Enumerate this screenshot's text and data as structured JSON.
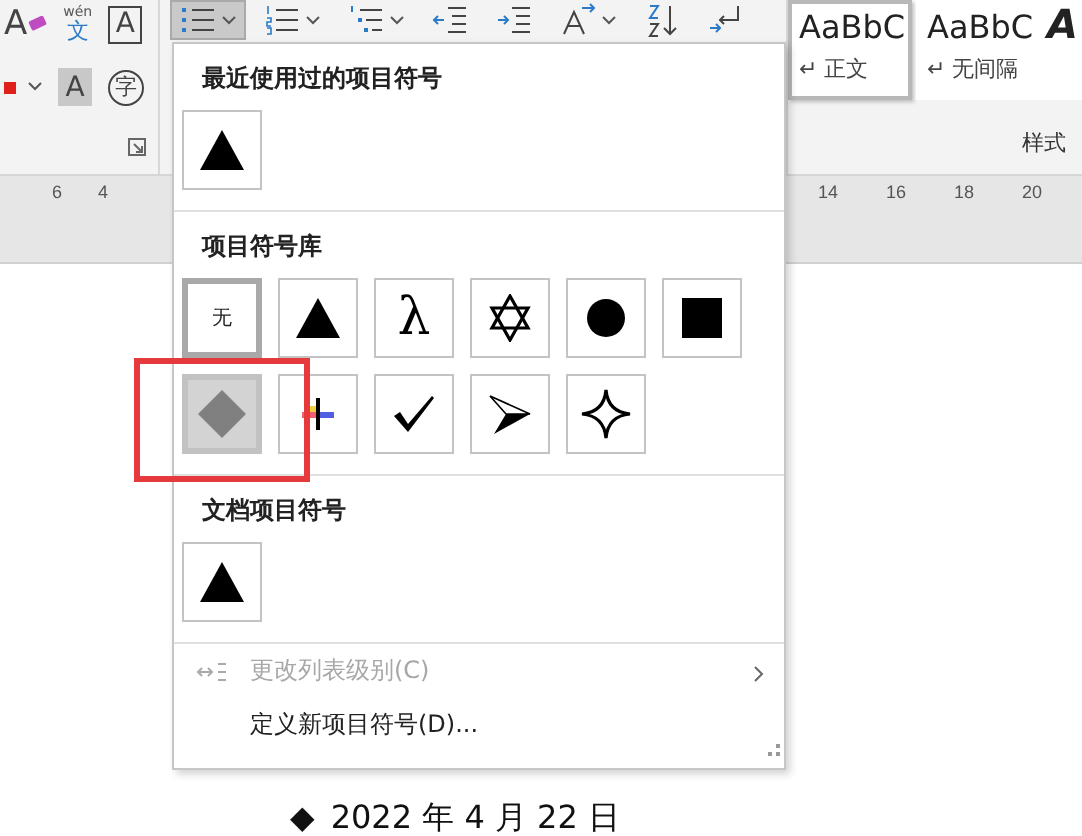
{
  "ribbon": {
    "font_tools": [
      {
        "kind": "clear",
        "glyph": "A"
      },
      {
        "kind": "pinyin",
        "ruby": "wén",
        "glyph": "文"
      },
      {
        "kind": "boxed",
        "glyph": "A"
      },
      {
        "kind": "color"
      },
      {
        "kind": "shaded",
        "glyph": "A"
      },
      {
        "kind": "enclosed",
        "glyph": "字"
      }
    ],
    "paragraph_tools": [
      {
        "kind": "bullets",
        "selected": true,
        "dropdown": true
      },
      {
        "kind": "numbering",
        "selected": false,
        "dropdown": true
      },
      {
        "kind": "multilevel",
        "selected": false,
        "dropdown": true
      },
      {
        "kind": "outdent",
        "selected": false,
        "dropdown": false
      },
      {
        "kind": "indent",
        "selected": false,
        "dropdown": false
      },
      {
        "kind": "text-direction",
        "selected": false,
        "dropdown": true
      },
      {
        "kind": "sort",
        "selected": false,
        "dropdown": false
      },
      {
        "kind": "marks",
        "selected": false,
        "dropdown": false
      }
    ],
    "styles": [
      {
        "kind": "normal",
        "preview": "AaBbC",
        "name": "↵ 正文",
        "selected": true
      },
      {
        "kind": "normal",
        "preview": "AaBbC",
        "name": "↵ 无间隔",
        "selected": false
      },
      {
        "kind": "heading",
        "preview": "A",
        "selected": false
      }
    ],
    "styles_label": "样式"
  },
  "ruler": {
    "left_marks": [
      "6",
      "4"
    ],
    "right_marks": [
      "14",
      "16",
      "18",
      "20"
    ]
  },
  "bullet_menu": {
    "sections": [
      {
        "title": "最近使用过的项目符号",
        "bullets": [
          {
            "kind": "triangle",
            "selected": false,
            "hovered": false
          }
        ]
      },
      {
        "title": "项目符号库",
        "bullets": [
          {
            "kind": "none",
            "label": "无",
            "selected": true,
            "hovered": false
          },
          {
            "kind": "triangle",
            "selected": false,
            "hovered": false
          },
          {
            "kind": "lambda",
            "glyph": "λ",
            "selected": false,
            "hovered": false
          },
          {
            "kind": "star-of-david",
            "selected": false,
            "hovered": false
          },
          {
            "kind": "circle",
            "selected": false,
            "hovered": false
          },
          {
            "kind": "square",
            "selected": false,
            "hovered": false
          },
          {
            "kind": "diamond",
            "selected": false,
            "hovered": true
          },
          {
            "kind": "plus",
            "selected": false,
            "hovered": false
          },
          {
            "kind": "check",
            "selected": false,
            "hovered": false
          },
          {
            "kind": "arrowhead",
            "selected": false,
            "hovered": false
          },
          {
            "kind": "four-point-star",
            "selected": false,
            "hovered": false
          }
        ]
      },
      {
        "title": "文档项目符号",
        "bullets": [
          {
            "kind": "triangle",
            "selected": false,
            "hovered": false
          }
        ]
      }
    ],
    "commands": [
      {
        "kind": "list-level",
        "label": "更改列表级别(C)",
        "disabled": true,
        "submenu": true
      },
      {
        "kind": "plain",
        "label": "定义新项目符号(D)...",
        "disabled": false,
        "submenu": false
      }
    ]
  },
  "document": {
    "bullet": "◆",
    "text": "2022 年 4 月 22 日"
  }
}
